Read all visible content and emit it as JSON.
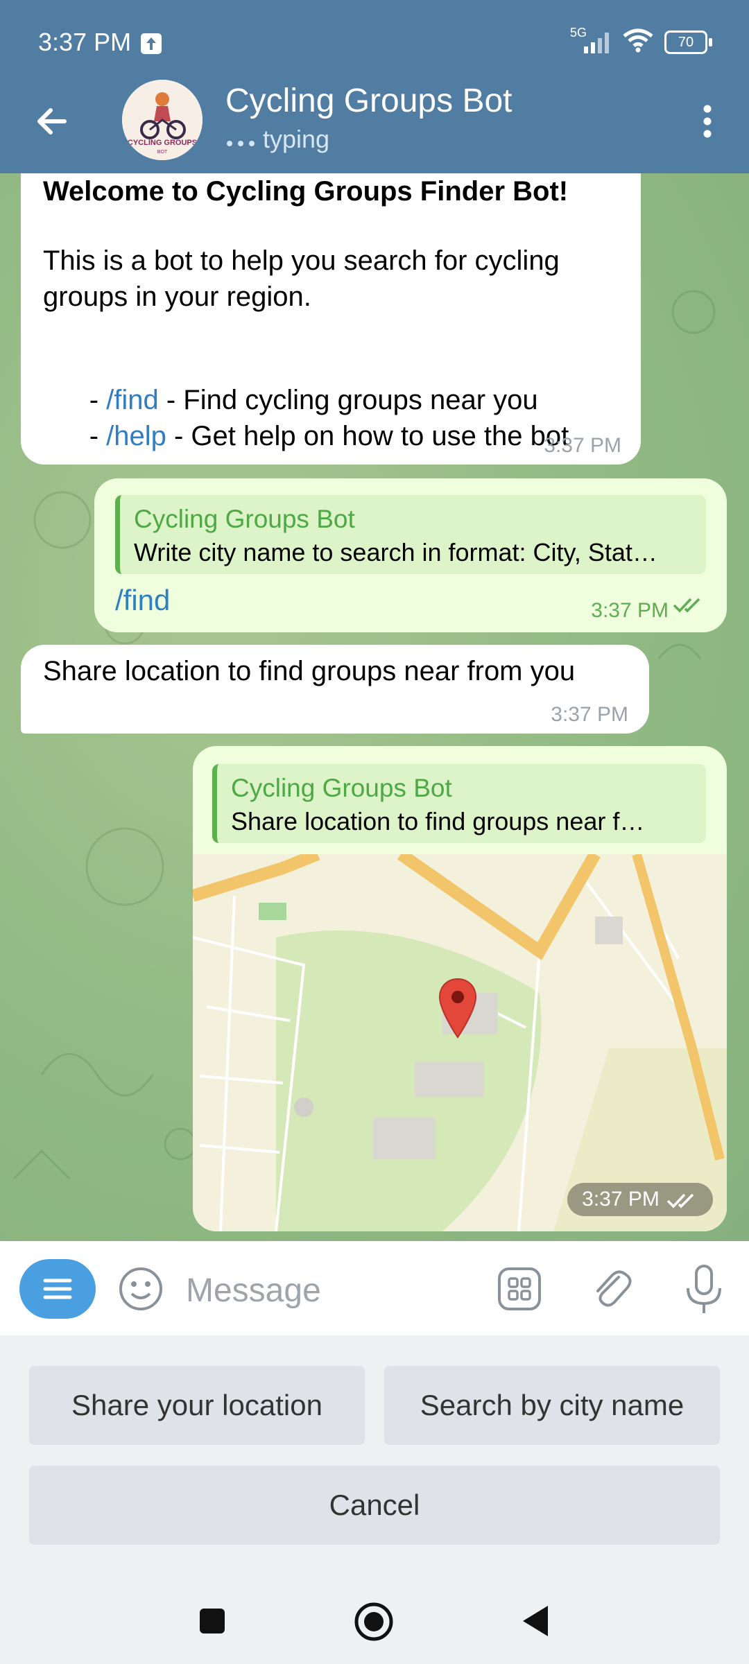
{
  "status_bar": {
    "time": "3:37 PM",
    "network": "5G",
    "battery": "70"
  },
  "header": {
    "title": "Cycling Groups Bot",
    "status": "typing",
    "avatar_text": "CYCLING GROUPS",
    "avatar_sub": "BOT"
  },
  "messages": {
    "welcome": {
      "title": "Welcome to Cycling Groups Finder Bot!",
      "line1": "This is a bot to help you search for cycling",
      "line2": "groups in your region.",
      "find_cmd": "/find",
      "find_desc": " - Find cycling groups near you",
      "help_cmd": "/help",
      "help_desc": " - Get help on how to use the bot",
      "dash": "- ",
      "time": "3:37 PM"
    },
    "find_reply": {
      "quote_title": "Cycling Groups Bot",
      "quote_text": "Write city name to search in format: City, Stat…",
      "text": "/find",
      "time": "3:37 PM"
    },
    "share_prompt": {
      "text": "Share location to find groups near from you",
      "time": "3:37 PM"
    },
    "location_reply": {
      "quote_title": "Cycling Groups Bot",
      "quote_text": "Share location to find groups near f…",
      "time": "3:37 PM"
    }
  },
  "input": {
    "placeholder": "Message"
  },
  "keyboard": {
    "share_location": "Share your location",
    "search_city": "Search by city name",
    "cancel": "Cancel"
  },
  "colors": {
    "header": "#517da2",
    "link": "#2f7ec2",
    "accent_green": "#5db14c"
  }
}
